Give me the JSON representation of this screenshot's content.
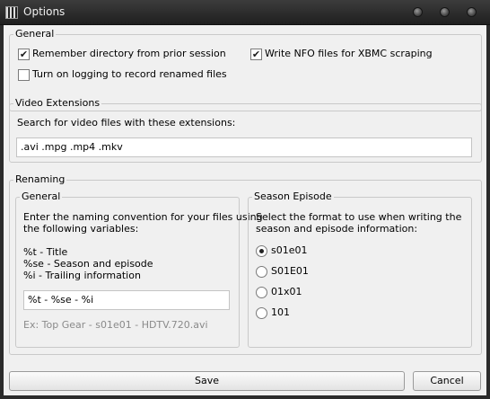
{
  "window": {
    "title": "Options"
  },
  "general": {
    "legend": "General",
    "remember_dir_label": "Remember directory from prior session",
    "remember_dir_checked": true,
    "write_nfo_label": "Write NFO files for XBMC scraping",
    "write_nfo_checked": true,
    "logging_label": "Turn on logging to record renamed files",
    "logging_checked": false
  },
  "video_extensions": {
    "legend": "Video Extensions",
    "prompt": "Search for video files with these extensions:",
    "value": ".avi .mpg .mp4 .mkv"
  },
  "renaming": {
    "legend": "Renaming",
    "general": {
      "legend": "General",
      "instructions_line1": "Enter the naming convention for your files using",
      "instructions_line2": "the following variables:",
      "var_title": "%t - Title",
      "var_season_episode": "%se - Season and episode",
      "var_trailing": "%i - Trailing information",
      "pattern_value": "%t - %se - %i",
      "example": "Ex: Top Gear - s01e01 - HDTV.720.avi"
    },
    "season_episode": {
      "legend": "Season Episode",
      "instructions_line1": "Select the format to use when writing the",
      "instructions_line2": "season and episode information:",
      "options": [
        {
          "label": "s01e01",
          "selected": true
        },
        {
          "label": "S01E01",
          "selected": false
        },
        {
          "label": "01x01",
          "selected": false
        },
        {
          "label": "101",
          "selected": false
        }
      ]
    }
  },
  "buttons": {
    "save": "Save",
    "cancel": "Cancel"
  },
  "icons": {
    "app": "clapperboard-icon",
    "window_buttons": [
      "minimize-icon",
      "maximize-icon",
      "close-icon"
    ]
  }
}
